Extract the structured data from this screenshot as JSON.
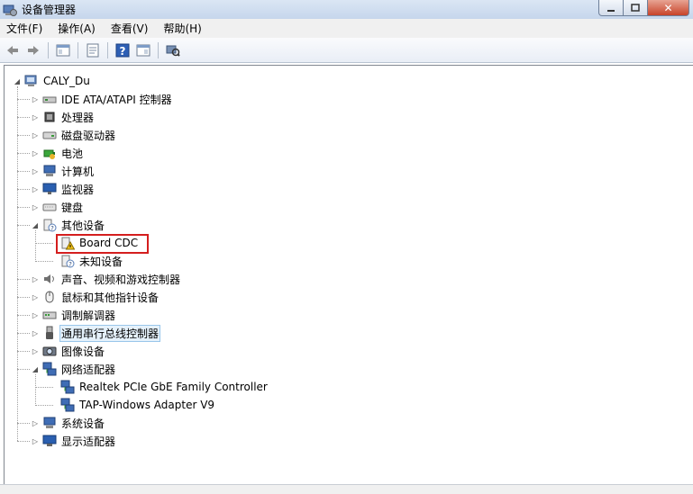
{
  "window": {
    "title": "设备管理器"
  },
  "menu": [
    "文件(F)",
    "操作(A)",
    "查看(V)",
    "帮助(H)"
  ],
  "toolbar": {
    "buttons": [
      "back-icon",
      "forward-icon",
      "show-hide-tree-icon",
      "properties-icon",
      "help-icon",
      "action-pane-icon",
      "scan-hardware-icon"
    ]
  },
  "tree": {
    "root": "CALY_Du",
    "items": [
      {
        "label": "IDE ATA/ATAPI 控制器",
        "icon": "ide-controller-icon",
        "expanded": false
      },
      {
        "label": "处理器",
        "icon": "processor-icon",
        "expanded": false
      },
      {
        "label": "磁盘驱动器",
        "icon": "disk-drive-icon",
        "expanded": false
      },
      {
        "label": "电池",
        "icon": "battery-icon",
        "expanded": false
      },
      {
        "label": "计算机",
        "icon": "computer-icon",
        "expanded": false
      },
      {
        "label": "监视器",
        "icon": "monitor-icon",
        "expanded": false
      },
      {
        "label": "键盘",
        "icon": "keyboard-icon",
        "expanded": false
      },
      {
        "label": "其他设备",
        "icon": "other-devices-icon",
        "expanded": true,
        "children": [
          {
            "label": "Board CDC",
            "icon": "warning-device-icon",
            "highlighted": true
          },
          {
            "label": "未知设备",
            "icon": "unknown-device-icon"
          }
        ]
      },
      {
        "label": "声音、视频和游戏控制器",
        "icon": "sound-icon",
        "expanded": false
      },
      {
        "label": "鼠标和其他指针设备",
        "icon": "mouse-icon",
        "expanded": false
      },
      {
        "label": "调制解调器",
        "icon": "modem-icon",
        "expanded": false
      },
      {
        "label": "通用串行总线控制器",
        "icon": "usb-icon",
        "expanded": false,
        "selected": true
      },
      {
        "label": "图像设备",
        "icon": "imaging-icon",
        "expanded": false
      },
      {
        "label": "网络适配器",
        "icon": "network-icon",
        "expanded": true,
        "children": [
          {
            "label": "Realtek PCIe GbE Family Controller",
            "icon": "network-adapter-icon"
          },
          {
            "label": "TAP-Windows Adapter V9",
            "icon": "network-adapter-icon"
          }
        ]
      },
      {
        "label": "系统设备",
        "icon": "system-devices-icon",
        "expanded": false
      },
      {
        "label": "显示适配器",
        "icon": "display-adapter-icon",
        "expanded": false
      }
    ]
  },
  "colors": {
    "highlight": "#d41e1e",
    "selection": "#e5f1fb"
  }
}
